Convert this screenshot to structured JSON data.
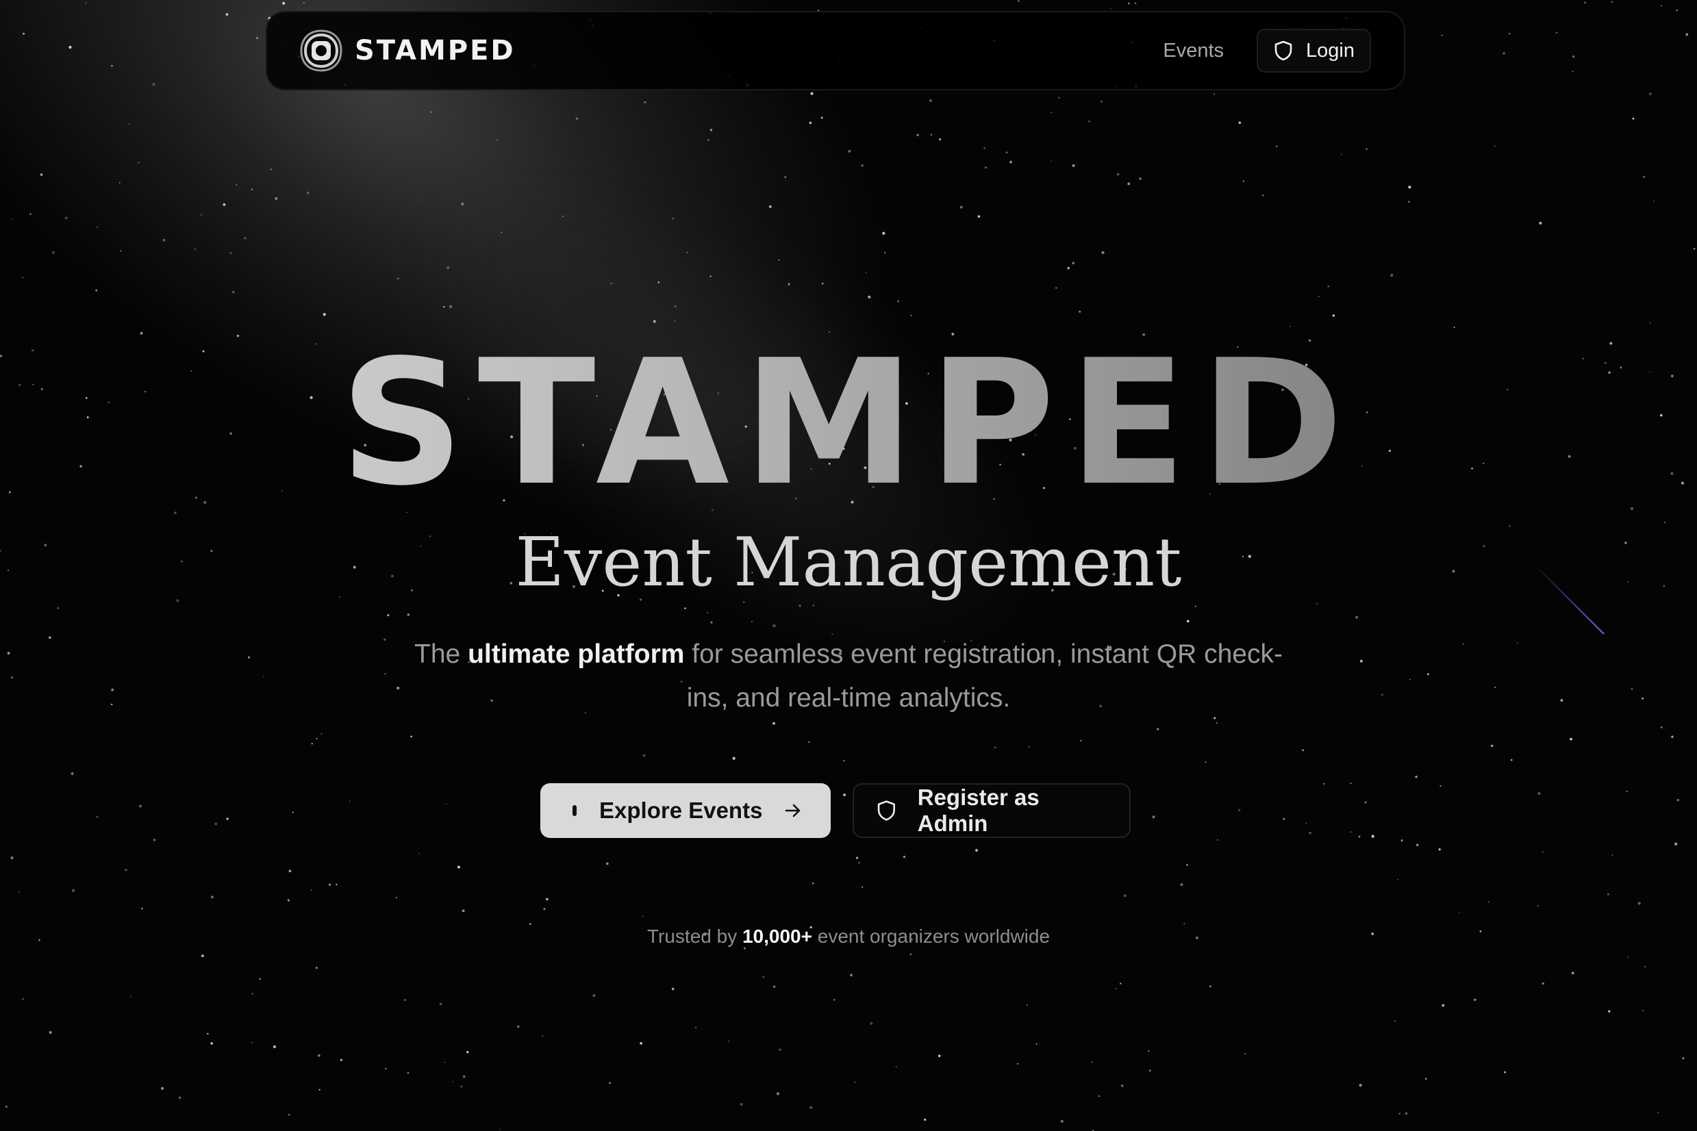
{
  "nav": {
    "brand": "STAMPED",
    "events_link": "Events",
    "login_label": "Login"
  },
  "hero": {
    "title": "STAMPED",
    "subtitle": "Event Management",
    "desc_prefix": "The ",
    "desc_highlight": "ultimate platform",
    "desc_suffix": " for seamless event registration, instant QR check-ins, and real-time analytics."
  },
  "actions": {
    "explore_label": "Explore Events",
    "register_label": "Register as Admin"
  },
  "trust": {
    "prefix": "Trusted by ",
    "count": "10,000+",
    "suffix": " event organizers worldwide"
  },
  "icons": {
    "logo": "stamp-logo-icon",
    "login": "shield-icon",
    "explore_left": "dot-icon",
    "explore_right": "arrow-right-icon",
    "register": "shield-icon"
  },
  "colors": {
    "background": "#040404",
    "primary_button": "#d9d9d9",
    "text_muted": "#9a9a9a",
    "accent_streak": "#7b4bd6"
  }
}
